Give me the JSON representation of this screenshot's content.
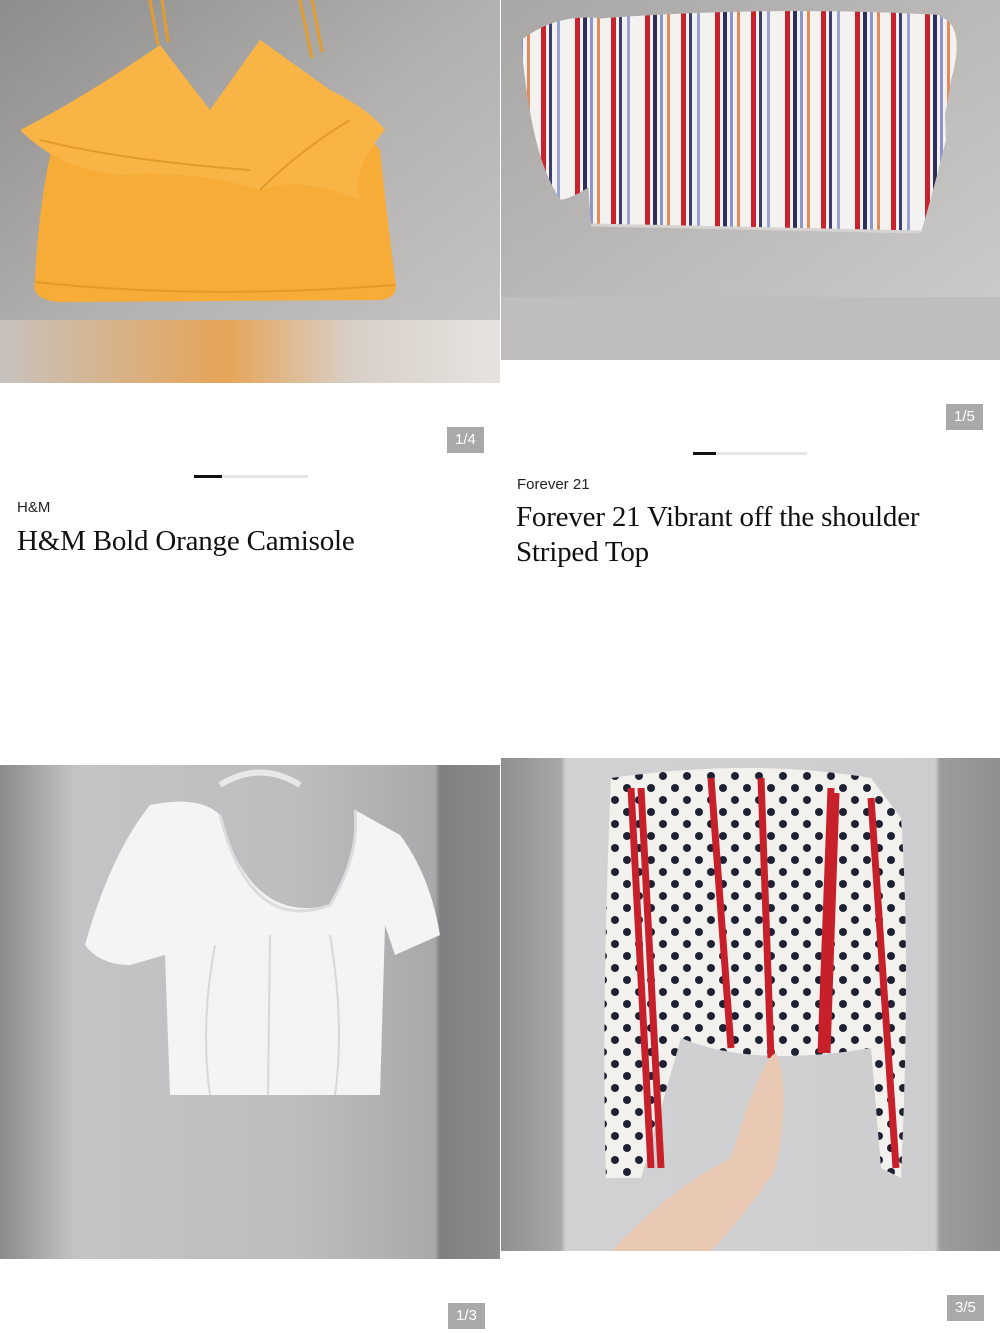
{
  "listings": [
    {
      "brand": "H&M",
      "title": "H&M Bold Orange Camisole",
      "counter": "1/4",
      "image_index": 1,
      "image_count": 4,
      "image_subject": "orange ruffled camisole on grey surface"
    },
    {
      "brand": "Forever 21",
      "title": "Forever 21 Vibrant off the shoulder Striped Top",
      "counter": "1/5",
      "image_index": 1,
      "image_count": 5,
      "image_subject": "white striped off-shoulder crop top"
    },
    {
      "counter": "1/3",
      "image_index": 1,
      "image_count": 3,
      "image_subject": "white scoop-neck corset tee on hanger"
    },
    {
      "counter": "3/5",
      "image_index": 3,
      "image_count": 5,
      "image_subject": "white polka dot red striped long sleeve top"
    }
  ],
  "colors": {
    "counter_bg": "#a9a9a9",
    "progress_track": "#e6e6e6",
    "progress_fill": "#111111",
    "orange_garment": "#f6ac37"
  }
}
